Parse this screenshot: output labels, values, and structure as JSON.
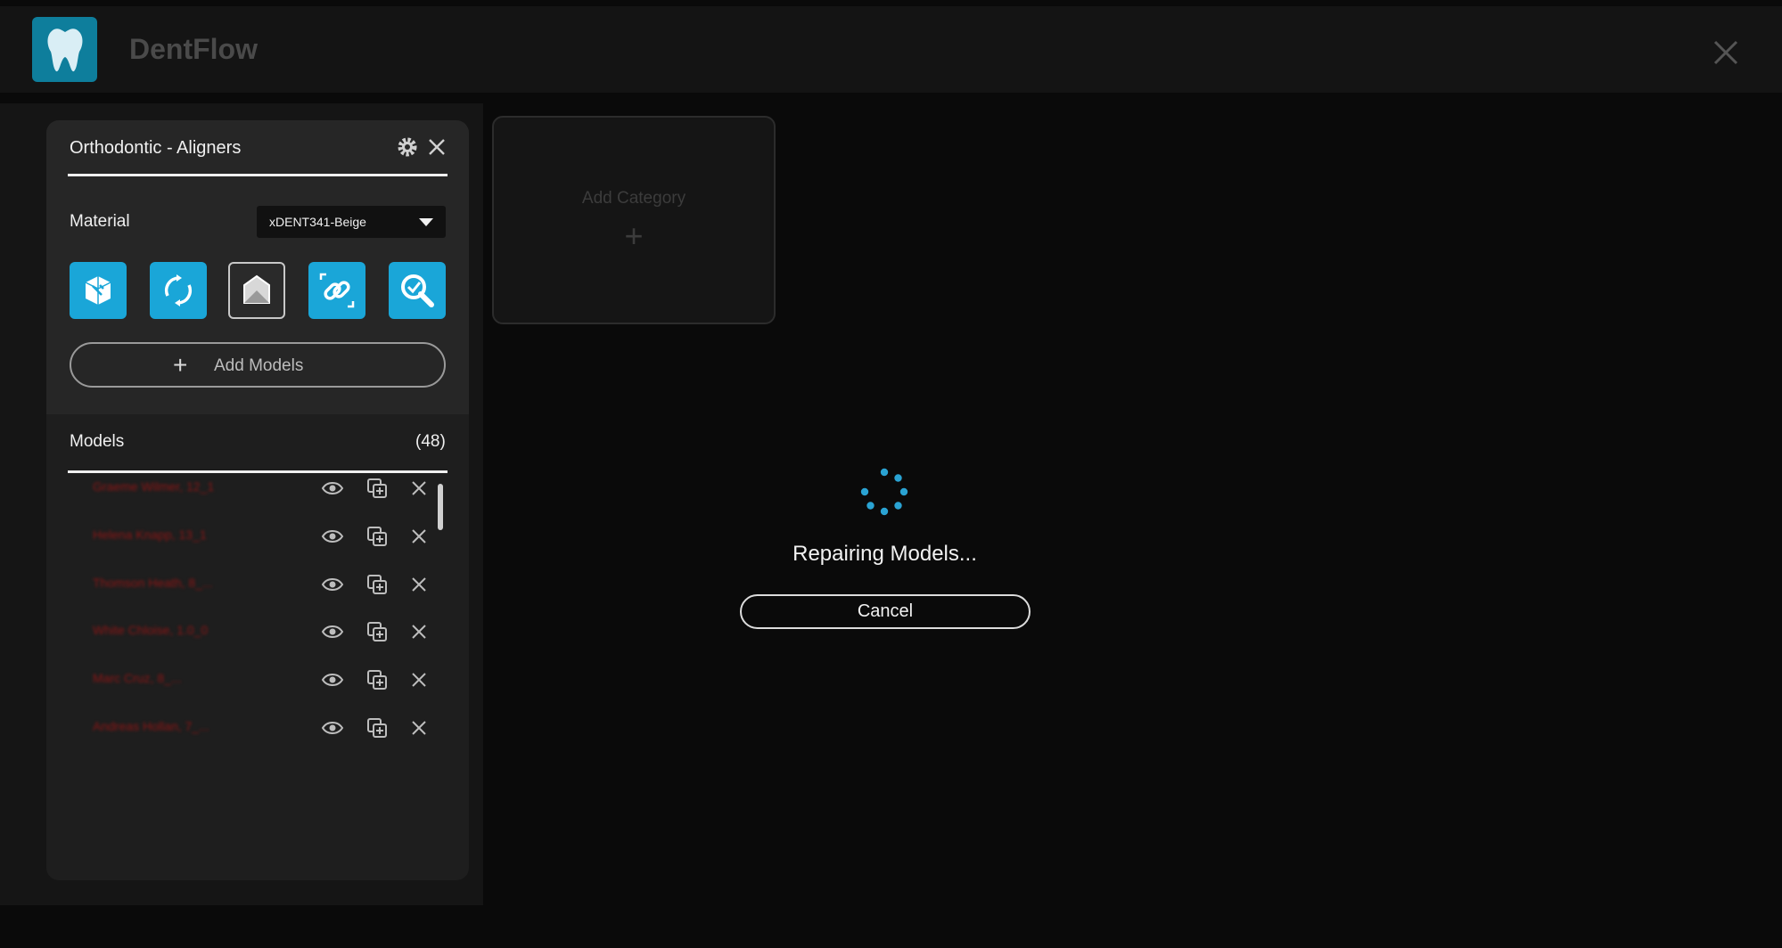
{
  "app": {
    "title": "DentFlow",
    "logo_icon": "tooth-icon",
    "accent": "#1aa6d8"
  },
  "panel": {
    "title": "Orthodontic - Aligners",
    "material_label": "Material",
    "material_value": "xDENT341-Beige",
    "tools": [
      "repair-cube-icon",
      "rotate-arrows-icon",
      "house-base-icon",
      "link-frame-icon",
      "magnify-check-icon"
    ],
    "add_models_label": "Add Models",
    "models_label": "Models",
    "models_count": "(48)",
    "models": [
      {
        "name": "Graeme Wilmer, 12_1"
      },
      {
        "name": "Helena Knapp, 13_1"
      },
      {
        "name": "Thomson Heath, 8_..."
      },
      {
        "name": "White Chloise, 1.0_0"
      },
      {
        "name": "Marc Cruz, 8_..."
      },
      {
        "name": "Andreas Hollan, 7_..."
      }
    ]
  },
  "category": {
    "add_label": "Add Category",
    "plus": "+"
  },
  "overlay": {
    "status": "Repairing Models...",
    "cancel_label": "Cancel"
  }
}
